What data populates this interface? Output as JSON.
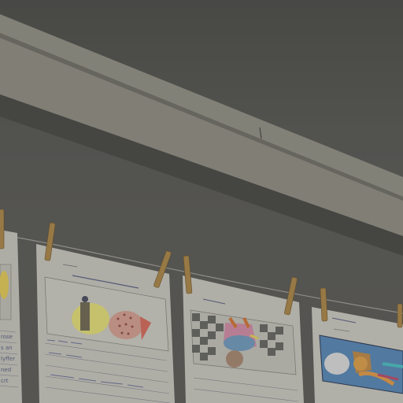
{
  "scene": {
    "description_tags": [
      "classroom",
      "student-drawings",
      "clothesline",
      "clothespins",
      "ceiling-beam"
    ],
    "colors": {
      "wall": "#5b5a56",
      "beam": "#8f8d83",
      "paper": "#bdbcb4",
      "clothespin": "#a4844c"
    }
  },
  "papers": [
    {
      "id": "paper-1",
      "handwriting": ""
    },
    {
      "id": "paper-2",
      "handwriting": ""
    },
    {
      "id": "paper-3",
      "handwriting": ""
    },
    {
      "id": "paper-4",
      "handwriting": ""
    }
  ]
}
